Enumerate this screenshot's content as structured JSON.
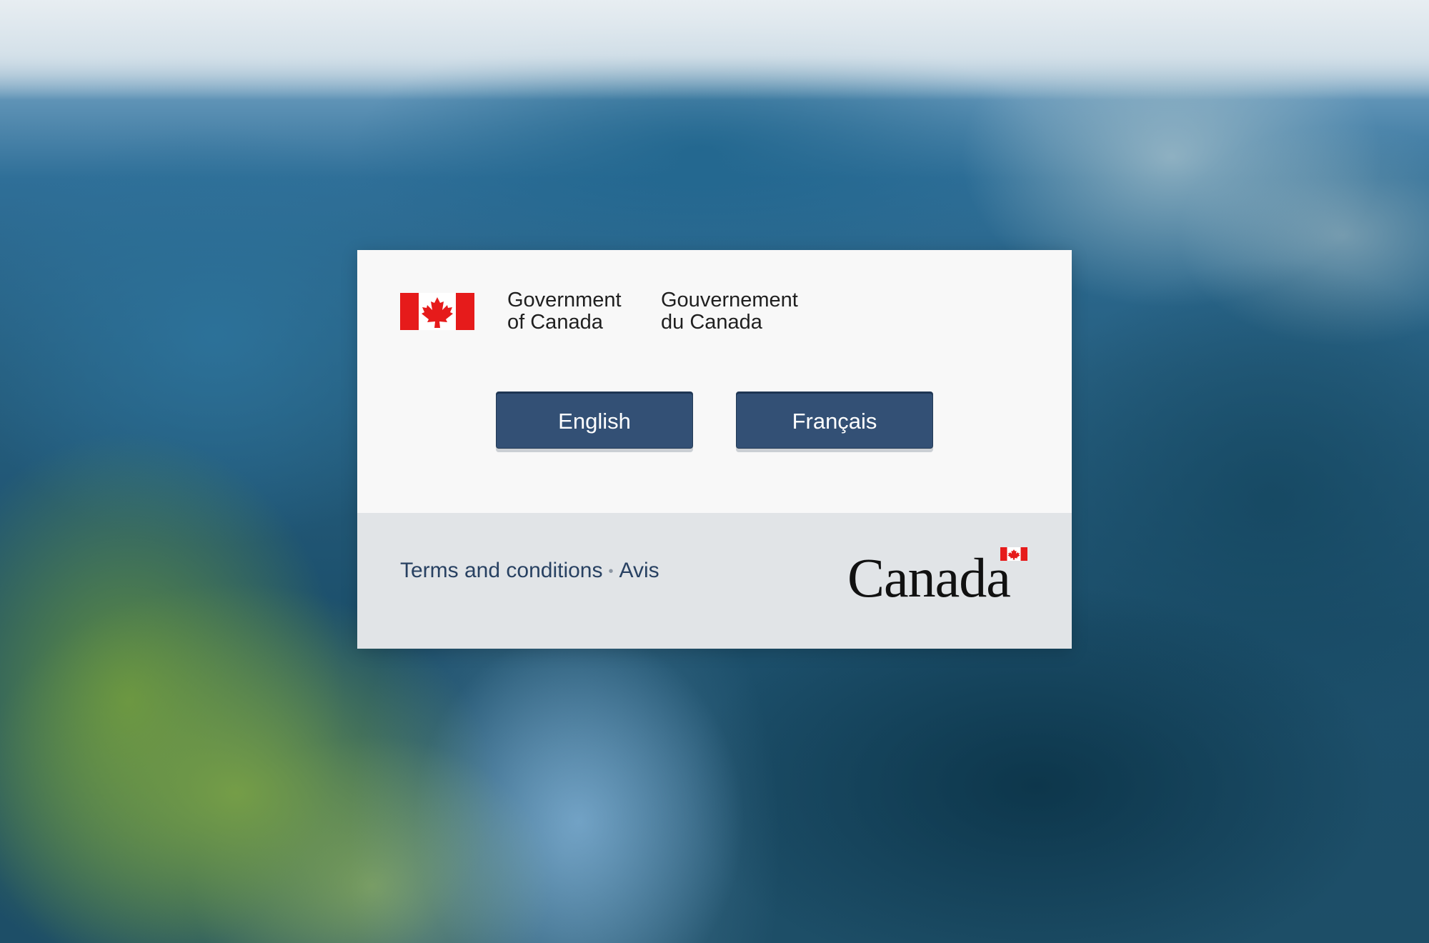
{
  "signature": {
    "flag_icon": "canada-flag-icon",
    "english": [
      "Government",
      "of Canada"
    ],
    "french": [
      "Gouvernement",
      "du Canada"
    ]
  },
  "language_buttons": {
    "english_label": "English",
    "french_label": "Français"
  },
  "footer": {
    "terms_label": "Terms and conditions",
    "separator": "•",
    "notice_label": "Avis",
    "wordmark_text": "Canada",
    "wordmark_flag_icon": "canada-flag-icon"
  },
  "colors": {
    "button_background": "#335075",
    "flag_red": "#e61b1b",
    "footer_background": "#e1e4e7",
    "link_color": "#284162"
  }
}
